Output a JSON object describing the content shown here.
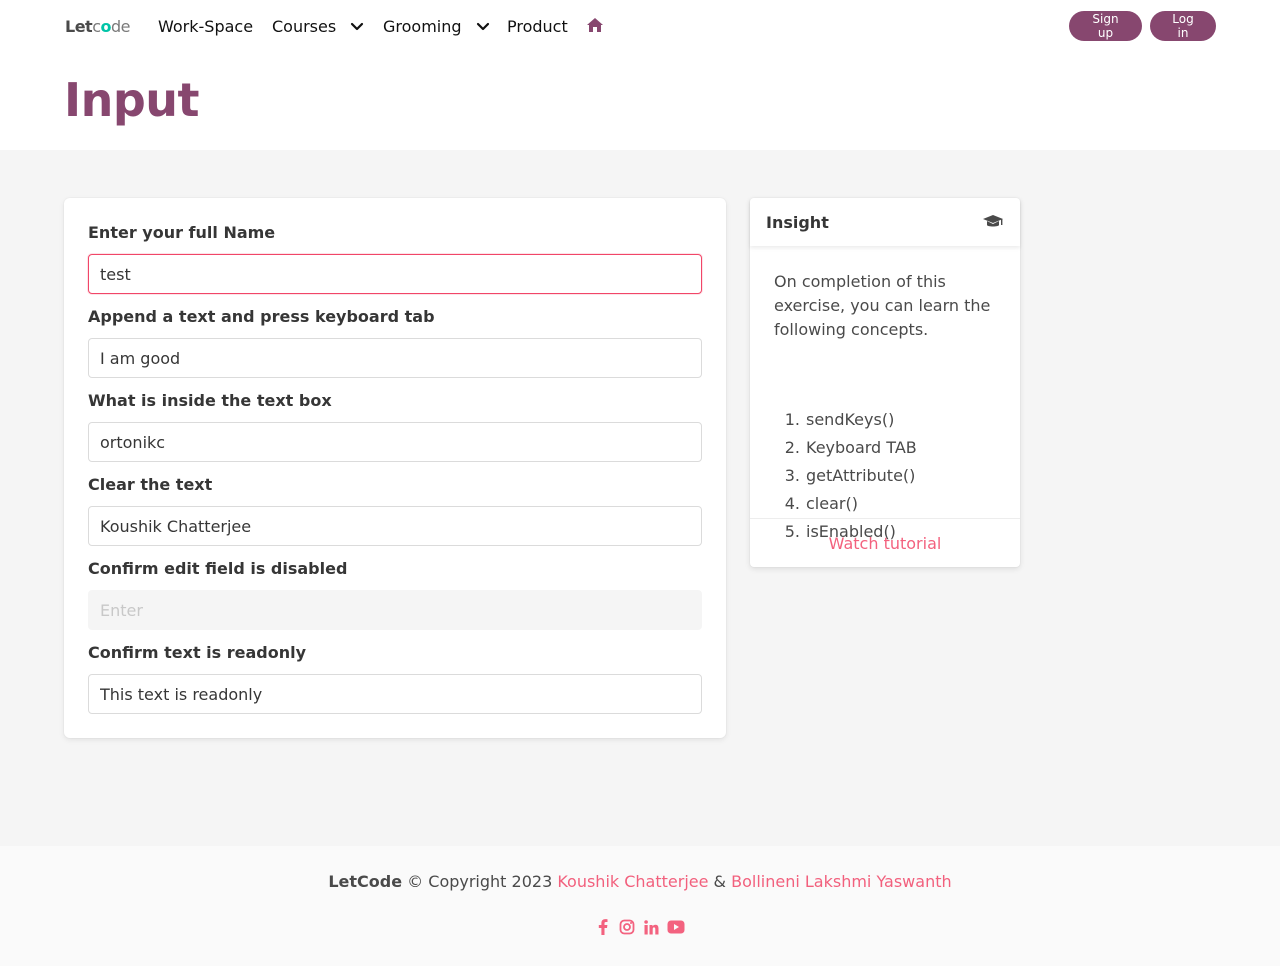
{
  "nav": {
    "logo": {
      "part1": "Let",
      "part2": "c",
      "part3": "o",
      "part4": "de"
    },
    "items": [
      {
        "label": "Work-Space"
      },
      {
        "label": "Courses"
      },
      {
        "label": "Grooming"
      },
      {
        "label": "Product"
      }
    ],
    "signup_label": "Sign up",
    "login_label": "Log in"
  },
  "hero": {
    "title": "Input"
  },
  "form": {
    "fields": [
      {
        "label": "Enter your full Name",
        "value": "test",
        "placeholder": ""
      },
      {
        "label": "Append a text and press keyboard tab",
        "value": "I am good",
        "placeholder": ""
      },
      {
        "label": "What is inside the text box",
        "value": "ortonikc",
        "placeholder": ""
      },
      {
        "label": "Clear the text",
        "value": "Koushik Chatterjee",
        "placeholder": ""
      },
      {
        "label": "Confirm edit field is disabled",
        "value": "",
        "placeholder": "Enter"
      },
      {
        "label": "Confirm text is readonly",
        "value": "This text is readonly",
        "placeholder": ""
      }
    ]
  },
  "insight": {
    "title": "Insight",
    "description": "On completion of this exercise, you can learn the following concepts.",
    "concepts": [
      {
        "num": "1.",
        "text": "sendKeys()"
      },
      {
        "num": "2.",
        "text": "Keyboard TAB"
      },
      {
        "num": "3.",
        "text": "getAttribute()"
      },
      {
        "num": "4.",
        "text": "clear()"
      },
      {
        "num": "5.",
        "text": "isEnabled()"
      }
    ],
    "footer_link": "Watch tutorial"
  },
  "footer": {
    "brand": "LetCode",
    "copyright": " © Copyright 2023 ",
    "author1": "Koushik Chatterjee",
    "amp": " & ",
    "author2": "Bollineni Lakshmi Yaswanth"
  },
  "colors": {
    "brand": "#87476f",
    "link": "#f14668",
    "section_bg": "#f5f5f5"
  }
}
